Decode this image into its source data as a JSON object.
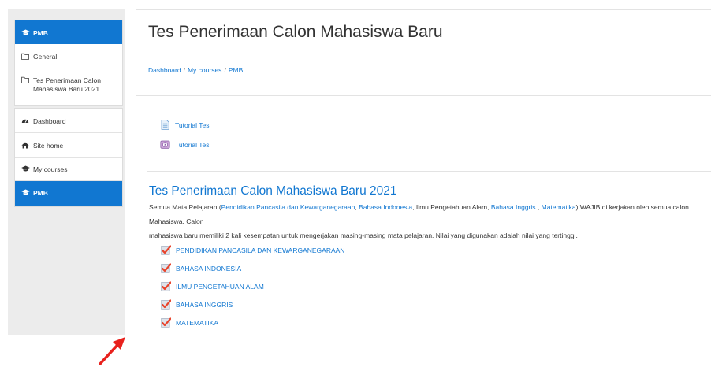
{
  "colors": {
    "accent": "#1177d1",
    "sidebar_bg": "#ececec",
    "arrow": "#e8211d"
  },
  "sidebar": {
    "course_block": [
      {
        "label": "PMB",
        "icon": "graduation-cap-icon",
        "active": true
      },
      {
        "label": "General",
        "icon": "folder-icon",
        "active": false
      },
      {
        "label_lines": [
          "Tes Penerimaan Calon",
          "Mahasiswa Baru 2021"
        ],
        "icon": "folder-icon",
        "active": false
      }
    ],
    "nav_block": [
      {
        "label": "Dashboard",
        "icon": "dashboard-icon",
        "active": false
      },
      {
        "label": "Site home",
        "icon": "home-icon",
        "active": false
      },
      {
        "label": "My courses",
        "icon": "graduation-cap-icon",
        "active": false
      },
      {
        "label": "PMB",
        "icon": "graduation-cap-icon",
        "active": true
      }
    ]
  },
  "header": {
    "title": "Tes Penerimaan Calon Mahasiswa Baru",
    "breadcrumb": [
      "Dashboard",
      "My courses",
      "PMB"
    ],
    "breadcrumb_separator": "/"
  },
  "main": {
    "general_items": [
      {
        "label": "Tutorial Tes",
        "icon": "file-icon"
      },
      {
        "label": "Tutorial Tes",
        "icon": "video-icon"
      }
    ],
    "section": {
      "title": "Tes Penerimaan Calon Mahasiswa Baru 2021",
      "summary": {
        "prefix": "Semua Mata Pelajaran (",
        "link1": "Pendidikan Pancasila dan Kewarganegaraan",
        "sep1": ", ",
        "link2": "Bahasa Indonesia",
        "middle": ", Ilmu Pengetahuan Alam, ",
        "link3": "Bahasa Inggris",
        "sep2": " , ",
        "link4": "Matematika",
        "rest1": ")  WAJIB di kerjakan oleh semua calon Mahasiswa. Calon",
        "line2": "mahasiswa baru memiliki 2 kali kesempatan untuk mengerjakan masing-masing mata pelajaran. Nilai yang digunakan adalah nilai yang tertinggi."
      },
      "quizzes": [
        "PENDIDIKAN PANCASILA DAN KEWARGANEGARAAN",
        "BAHASA INDONESIA",
        "ILMU PENGETAHUAN ALAM",
        "BAHASA INGGRIS",
        "MATEMATIKA"
      ]
    }
  }
}
